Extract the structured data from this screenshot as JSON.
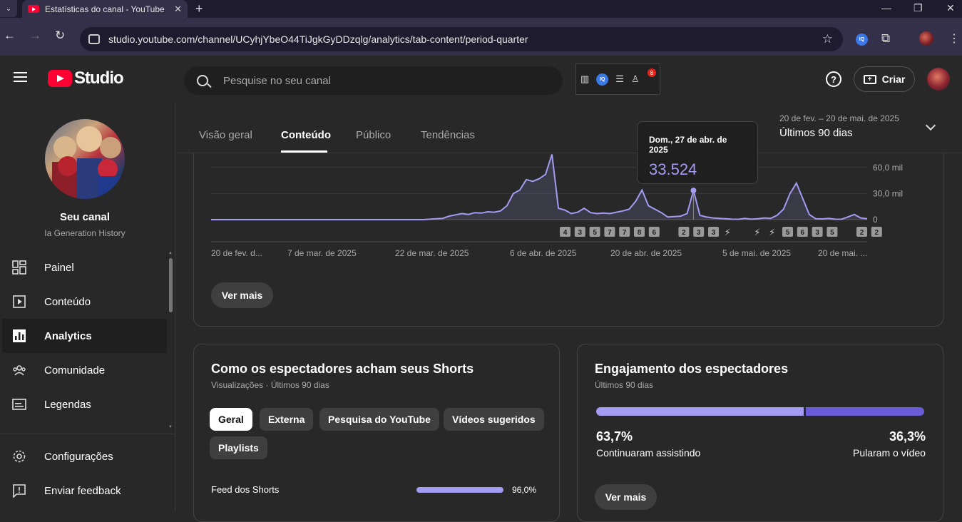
{
  "browser": {
    "tab_title": "Estatísticas do canal - YouTube",
    "tab_close": "✕",
    "new_tab": "+",
    "tab_dropdown": "⌄",
    "url": "studio.youtube.com/channel/UCyhjYbeO44TiJgkGyDDzqlg/analytics/tab-content/period-quarter",
    "window_controls": [
      "—",
      "❐",
      "✕"
    ],
    "nav": {
      "back": "←",
      "forward": "→",
      "reload": "↻"
    },
    "ext_iq": "IQ"
  },
  "header": {
    "logo_text": "Studio",
    "search_placeholder": "Pesquise no seu canal",
    "ext_iq": "IQ",
    "ext_badge": "8",
    "help": "?",
    "create_label": "Criar"
  },
  "sidebar": {
    "channel_title": "Seu canal",
    "channel_name": "Ia Generation History",
    "items": [
      {
        "label": "Painel",
        "icon": "dashboard-icon",
        "active": false
      },
      {
        "label": "Conteúdo",
        "icon": "content-icon",
        "active": false
      },
      {
        "label": "Analytics",
        "icon": "analytics-icon",
        "active": true
      },
      {
        "label": "Comunidade",
        "icon": "community-icon",
        "active": false
      },
      {
        "label": "Legendas",
        "icon": "subtitles-icon",
        "active": false
      },
      {
        "label": "Configurações",
        "icon": "gear-icon",
        "active": false
      },
      {
        "label": "Enviar feedback",
        "icon": "feedback-icon",
        "active": false
      }
    ]
  },
  "main": {
    "tabs": [
      "Visão geral",
      "Conteúdo",
      "Público",
      "Tendências"
    ],
    "active_tab": "Conteúdo",
    "period_range": "20 de fev. – 20 de mai. de 2025",
    "period_label": "Últimos 90 dias",
    "see_more": "Ver mais"
  },
  "tooltip": {
    "date": "Dom., 27 de abr. de 2025",
    "value": "33.524"
  },
  "chart_data": {
    "type": "area",
    "x_labels": [
      "20 de fev. d...",
      "7 de mar. de 2025",
      "22 de mar. de 2025",
      "6 de abr. de 2025",
      "20 de abr. de 2025",
      "5 de mai. de 2025",
      "20 de mai. ..."
    ],
    "y_ticks": [
      "60,0 mil",
      "30,0 mil",
      "0"
    ],
    "ylim": [
      0,
      75000
    ],
    "color": "#a49bf2",
    "values": [
      0,
      0,
      0,
      0,
      0,
      0,
      0,
      0,
      0,
      0,
      0,
      0,
      0,
      0,
      0,
      0,
      0,
      0,
      0,
      0,
      0,
      0,
      0,
      0,
      0,
      0,
      0,
      0,
      0,
      0,
      0,
      0,
      0,
      0,
      500,
      1000,
      1500,
      4000,
      5500,
      7000,
      6000,
      8000,
      7500,
      9000,
      8500,
      10000,
      16000,
      30000,
      34000,
      46000,
      44000,
      47000,
      52000,
      82000,
      13000,
      11000,
      7000,
      8500,
      13000,
      8000,
      7000,
      7500,
      7000,
      8500,
      10000,
      12000,
      21000,
      34000,
      16000,
      12000,
      8000,
      3000,
      3500,
      4000,
      7000,
      33524,
      5000,
      3000,
      2000,
      1500,
      1000,
      500,
      400,
      1500,
      500,
      1000,
      2000,
      1500,
      5000,
      12000,
      30000,
      42000,
      24000,
      6000,
      1000,
      800,
      1500,
      500,
      400,
      3000,
      6000,
      2000,
      1000
    ],
    "upload_markers": [
      "4",
      "3",
      "5",
      "7",
      "7",
      "8",
      "6",
      "",
      "2",
      "3",
      "3",
      "s",
      "",
      "s",
      "s",
      "5",
      "6",
      "3",
      "5",
      "",
      "2",
      "2"
    ]
  },
  "shorts_card": {
    "title": "Como os espectadores acham seus Shorts",
    "subtitle": "Visualizações · Últimos 90 dias",
    "chips": [
      "Geral",
      "Externa",
      "Pesquisa do YouTube",
      "Vídeos sugeridos",
      "Playlists"
    ],
    "rows": [
      {
        "label": "Feed dos Shorts",
        "value": "96,0%",
        "share": 0.96
      }
    ]
  },
  "engagement_card": {
    "title": "Engajamento dos espectadores",
    "subtitle": "Últimos 90 dias",
    "continued_pct": "63,7%",
    "continued_label": "Continuaram assistindo",
    "skipped_pct": "36,3%",
    "skipped_label": "Pularam o vídeo",
    "see_more": "Ver mais"
  }
}
